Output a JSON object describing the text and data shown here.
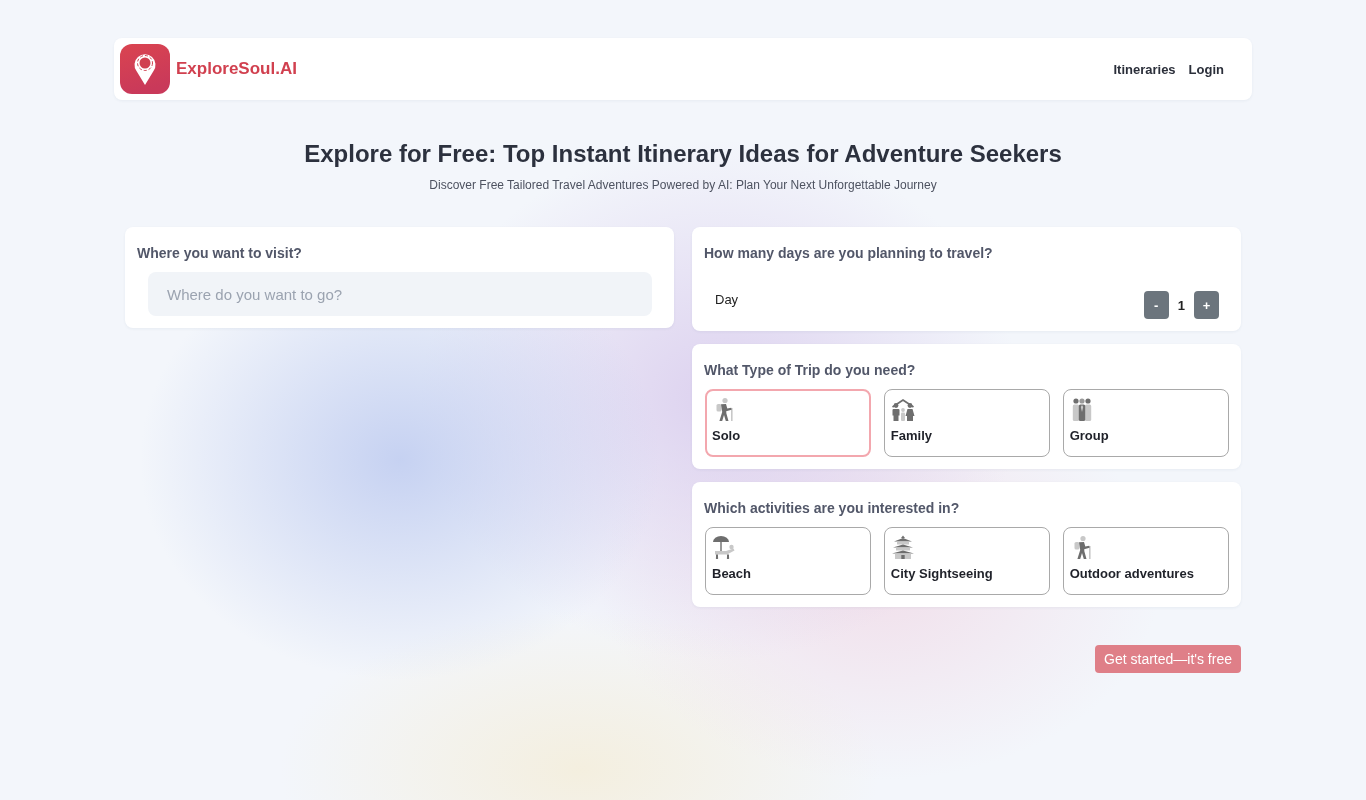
{
  "header": {
    "brand": "ExploreSoul.AI",
    "nav": [
      "Itineraries",
      "Login"
    ]
  },
  "hero": {
    "title": "Explore for Free: Top Instant Itinerary Ideas for Adventure Seekers",
    "subtitle": "Discover Free Tailored Travel Adventures Powered by AI: Plan Your Next Unforgettable Journey"
  },
  "destination": {
    "question": "Where you want to visit?",
    "placeholder": "Where do you want to go?"
  },
  "days": {
    "question": "How many days are you planning to travel?",
    "label": "Day",
    "decrement": "-",
    "value": "1",
    "increment": "+"
  },
  "trip_type": {
    "question": "What Type of Trip do you need?",
    "options": [
      {
        "label": "Solo",
        "kind": "hiker",
        "selected": true
      },
      {
        "label": "Family",
        "kind": "family",
        "selected": false
      },
      {
        "label": "Group",
        "kind": "group",
        "selected": false
      }
    ]
  },
  "activities": {
    "question": "Which activities are you interested in?",
    "options": [
      {
        "label": "Beach",
        "kind": "beach",
        "selected": false
      },
      {
        "label": "City Sightseeing",
        "kind": "pagoda",
        "selected": false
      },
      {
        "label": "Outdoor adventures",
        "kind": "hiker",
        "selected": false
      }
    ]
  },
  "cta": "Get started—it's free"
}
